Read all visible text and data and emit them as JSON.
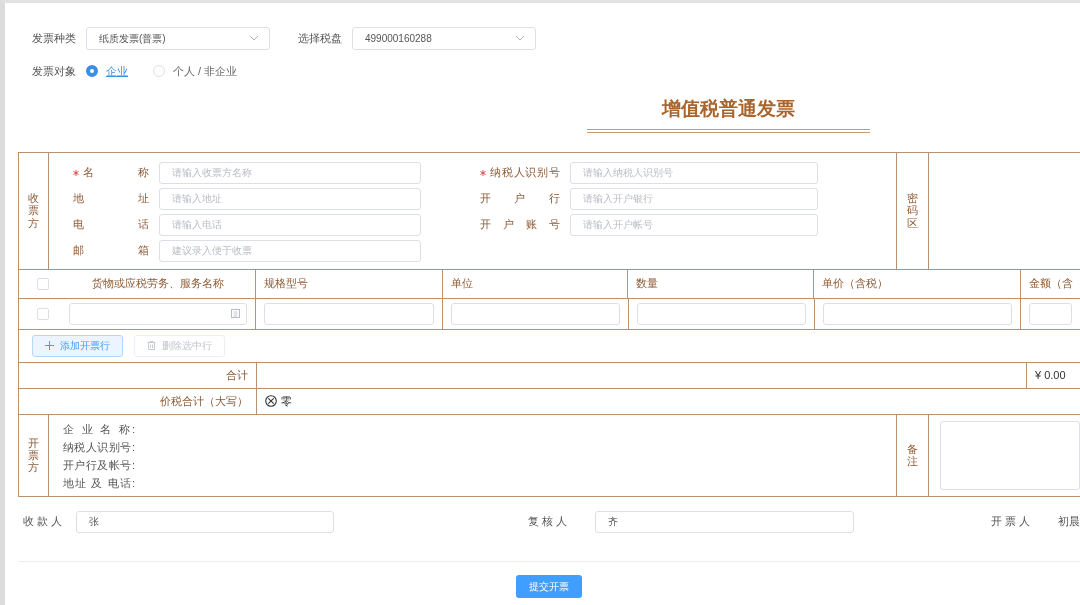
{
  "header_fields": [
    {
      "label": "发票种类",
      "value": "纸质发票(普票)"
    },
    {
      "label": "选择税盘",
      "value": "499000160288"
    }
  ],
  "invoice_target": {
    "label": "发票对象",
    "options": [
      {
        "label": "企业",
        "selected": true
      },
      {
        "label": "个人 / 非企业",
        "selected": false
      }
    ]
  },
  "title": "增值税普通发票",
  "buyer": {
    "section_label": "收票方",
    "cipher_label": "密码区",
    "left_fields": [
      {
        "label": "名 称",
        "required": true,
        "placeholder": "请输入收票方名称"
      },
      {
        "label": "地 址",
        "required": false,
        "placeholder": "请输入地址"
      },
      {
        "label": "电 话",
        "required": false,
        "placeholder": "请输入电话"
      },
      {
        "label": "邮 箱",
        "required": false,
        "placeholder": "建议录入便于收票"
      }
    ],
    "right_fields": [
      {
        "label": "纳税人识别号",
        "required": true,
        "placeholder": "请输入纳税人识别号"
      },
      {
        "label": "开 户 行",
        "required": false,
        "placeholder": "请输入开户银行"
      },
      {
        "label": "开 户 账 号",
        "required": false,
        "placeholder": "请输入开户帐号"
      }
    ]
  },
  "items": {
    "all_checked": false,
    "columns": [
      {
        "label": "货物或应税劳务、服务名称"
      },
      {
        "label": "规格型号"
      },
      {
        "label": "单位"
      },
      {
        "label": "数量"
      },
      {
        "label": "单价（含税）"
      },
      {
        "label": "金额（含"
      }
    ],
    "rows": [
      {
        "checked": false
      }
    ]
  },
  "row_buttons": [
    {
      "label": "添加开票行",
      "kind": "add",
      "disabled": false
    },
    {
      "label": "删除选中行",
      "kind": "delete",
      "disabled": true
    }
  ],
  "total": {
    "label": "合计",
    "amount": "¥ 0.00"
  },
  "total_in_words": {
    "label": "价税合计（大写）",
    "value": "零"
  },
  "seller": {
    "section_label": "开票方",
    "remarks_label": "备注",
    "fields": [
      {
        "label": "企 业 名 称:"
      },
      {
        "label": "纳税人识别号:"
      },
      {
        "label": "开户行及帐号:"
      },
      {
        "label": "地址 及 电话:"
      }
    ]
  },
  "signatures": [
    {
      "label": "收 款 人",
      "kind": "field",
      "value": "张"
    },
    {
      "label": "复 核 人",
      "kind": "field",
      "value": "齐"
    },
    {
      "label": "开 票 人",
      "kind": "text",
      "value": "初晨"
    }
  ],
  "submit_button": "提交开票"
}
